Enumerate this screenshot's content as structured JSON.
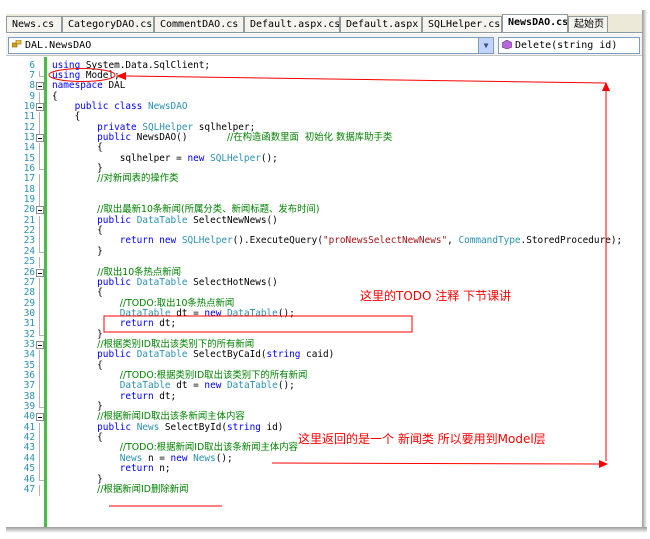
{
  "tabs": [
    {
      "label": "News.cs",
      "active": false
    },
    {
      "label": "CategoryDAO.cs",
      "active": false
    },
    {
      "label": "CommentDAO.cs",
      "active": false
    },
    {
      "label": "Default.aspx.cs",
      "active": false
    },
    {
      "label": "Default.aspx",
      "active": false
    },
    {
      "label": "SQLHelper.cs",
      "active": false
    },
    {
      "label": "NewsDAO.cs",
      "active": true
    },
    {
      "label": "起始页",
      "active": false
    }
  ],
  "navbar": {
    "type_combo": "DAL.NewsDAO",
    "member_combo": "Delete(string id)",
    "type_icon": "class-icon",
    "member_icon": "method-icon",
    "arrow_icon": "chevron-down-icon"
  },
  "colors": {
    "keyword": "#0000ff",
    "type": "#2b91af",
    "comment": "#008000",
    "string": "#a31515",
    "line_number": "#2b91af",
    "annotation": "#ff0000",
    "change_bar": "#4cbb4c"
  },
  "lines": [
    {
      "num": "6",
      "fold": "none",
      "segs": [
        [
          "k",
          "using"
        ],
        [
          "p",
          " System.Data.SqlClient;"
        ]
      ]
    },
    {
      "num": "7",
      "fold": "end",
      "segs": [
        [
          "k",
          "using"
        ],
        [
          "p",
          " Model;"
        ]
      ]
    },
    {
      "num": "8",
      "fold": "box",
      "segs": [
        [
          "k",
          "namespace"
        ],
        [
          "p",
          " DAL"
        ]
      ]
    },
    {
      "num": "9",
      "fold": "vl",
      "segs": [
        [
          "p",
          "{"
        ]
      ]
    },
    {
      "num": "10",
      "fold": "box",
      "segs": [
        [
          "p",
          "    "
        ],
        [
          "k",
          "public class"
        ],
        [
          "p",
          " "
        ],
        [
          "t",
          "NewsDAO"
        ]
      ]
    },
    {
      "num": "11",
      "fold": "vl",
      "segs": [
        [
          "p",
          "    {"
        ]
      ]
    },
    {
      "num": "12",
      "fold": "vl",
      "segs": [
        [
          "p",
          "        "
        ],
        [
          "k",
          "private"
        ],
        [
          "p",
          " "
        ],
        [
          "t",
          "SQLHelper"
        ],
        [
          "p",
          " sqlhelper;"
        ]
      ]
    },
    {
      "num": "13",
      "fold": "box",
      "segs": [
        [
          "p",
          "        "
        ],
        [
          "k",
          "public"
        ],
        [
          "p",
          " NewsDAO()       "
        ],
        [
          "c",
          "//在构造函数里面  初始化 数据库助手类"
        ]
      ]
    },
    {
      "num": "14",
      "fold": "vl",
      "segs": [
        [
          "p",
          "        {"
        ]
      ]
    },
    {
      "num": "15",
      "fold": "vl",
      "segs": [
        [
          "p",
          "            sqlhelper = "
        ],
        [
          "k",
          "new"
        ],
        [
          "p",
          " "
        ],
        [
          "t",
          "SQLHelper"
        ],
        [
          "p",
          "();"
        ]
      ]
    },
    {
      "num": "16",
      "fold": "end",
      "segs": [
        [
          "p",
          "        }"
        ]
      ]
    },
    {
      "num": "17",
      "fold": "vl",
      "segs": [
        [
          "p",
          "        "
        ],
        [
          "c",
          "//对新闻表的操作类"
        ]
      ]
    },
    {
      "num": "18",
      "fold": "vl",
      "segs": [
        [
          "p",
          ""
        ]
      ]
    },
    {
      "num": "19",
      "fold": "vl",
      "segs": [
        [
          "p",
          ""
        ]
      ]
    },
    {
      "num": "20",
      "fold": "box",
      "segs": [
        [
          "p",
          "        "
        ],
        [
          "c",
          "//取出最新10条新闻(所属分类、新闻标题、发布时间)"
        ]
      ]
    },
    {
      "num": "21",
      "fold": "vl",
      "segs": [
        [
          "p",
          "        "
        ],
        [
          "k",
          "public"
        ],
        [
          "p",
          " "
        ],
        [
          "t",
          "DataTable"
        ],
        [
          "p",
          " SelectNewNews()"
        ]
      ]
    },
    {
      "num": "22",
      "fold": "vl",
      "segs": [
        [
          "p",
          "        {"
        ]
      ]
    },
    {
      "num": "23",
      "fold": "vl",
      "segs": [
        [
          "p",
          "            "
        ],
        [
          "k",
          "return new"
        ],
        [
          "p",
          " "
        ],
        [
          "t",
          "SQLHelper"
        ],
        [
          "p",
          "().ExecuteQuery("
        ],
        [
          "s",
          "\"proNewsSelectNewNews\""
        ],
        [
          "p",
          ", "
        ],
        [
          "t",
          "CommandType"
        ],
        [
          "p",
          ".StoredProcedure);"
        ]
      ]
    },
    {
      "num": "24",
      "fold": "end",
      "segs": [
        [
          "p",
          "        }"
        ]
      ]
    },
    {
      "num": "25",
      "fold": "vl",
      "segs": [
        [
          "p",
          ""
        ]
      ]
    },
    {
      "num": "26",
      "fold": "box",
      "segs": [
        [
          "p",
          "        "
        ],
        [
          "c",
          "//取出10条热点新闻"
        ]
      ]
    },
    {
      "num": "27",
      "fold": "vl",
      "segs": [
        [
          "p",
          "        "
        ],
        [
          "k",
          "public"
        ],
        [
          "p",
          " "
        ],
        [
          "t",
          "DataTable"
        ],
        [
          "p",
          " SelectHotNews()"
        ]
      ]
    },
    {
      "num": "28",
      "fold": "vl",
      "segs": [
        [
          "p",
          "        {"
        ]
      ]
    },
    {
      "num": "29",
      "fold": "vl",
      "segs": [
        [
          "p",
          "            "
        ],
        [
          "c",
          "//TODO:取出10条热点新闻"
        ]
      ]
    },
    {
      "num": "30",
      "fold": "vl",
      "segs": [
        [
          "p",
          "            "
        ],
        [
          "t",
          "DataTable"
        ],
        [
          "p",
          " dt = "
        ],
        [
          "k",
          "new"
        ],
        [
          "p",
          " "
        ],
        [
          "t",
          "DataTable"
        ],
        [
          "p",
          "();"
        ]
      ]
    },
    {
      "num": "31",
      "fold": "vl",
      "segs": [
        [
          "p",
          "            "
        ],
        [
          "k",
          "return"
        ],
        [
          "p",
          " dt;"
        ]
      ]
    },
    {
      "num": "32",
      "fold": "end",
      "segs": [
        [
          "p",
          "        }"
        ]
      ]
    },
    {
      "num": "33",
      "fold": "box",
      "segs": [
        [
          "p",
          "        "
        ],
        [
          "c",
          "//根据类别ID取出该类别下的所有新闻"
        ]
      ]
    },
    {
      "num": "34",
      "fold": "vl",
      "segs": [
        [
          "p",
          "        "
        ],
        [
          "k",
          "public"
        ],
        [
          "p",
          " "
        ],
        [
          "t",
          "DataTable"
        ],
        [
          "p",
          " SelectByCaId("
        ],
        [
          "k",
          "string"
        ],
        [
          "p",
          " caid)"
        ]
      ]
    },
    {
      "num": "35",
      "fold": "vl",
      "segs": [
        [
          "p",
          "        {"
        ]
      ]
    },
    {
      "num": "36",
      "fold": "vl",
      "segs": [
        [
          "p",
          "            "
        ],
        [
          "c",
          "//TODO:根据类别ID取出该类别下的所有新闻"
        ]
      ]
    },
    {
      "num": "37",
      "fold": "vl",
      "segs": [
        [
          "p",
          "            "
        ],
        [
          "t",
          "DataTable"
        ],
        [
          "p",
          " dt = "
        ],
        [
          "k",
          "new"
        ],
        [
          "p",
          " "
        ],
        [
          "t",
          "DataTable"
        ],
        [
          "p",
          "();"
        ]
      ]
    },
    {
      "num": "38",
      "fold": "vl",
      "segs": [
        [
          "p",
          "            "
        ],
        [
          "k",
          "return"
        ],
        [
          "p",
          " dt;"
        ]
      ]
    },
    {
      "num": "39",
      "fold": "end",
      "segs": [
        [
          "p",
          "        }"
        ]
      ]
    },
    {
      "num": "40",
      "fold": "box",
      "segs": [
        [
          "p",
          "        "
        ],
        [
          "c",
          "//根据新闻ID取出该条新闻主体内容"
        ]
      ]
    },
    {
      "num": "41",
      "fold": "vl",
      "segs": [
        [
          "p",
          "        "
        ],
        [
          "k",
          "public"
        ],
        [
          "p",
          " "
        ],
        [
          "t",
          "News"
        ],
        [
          "p",
          " SelectById("
        ],
        [
          "k",
          "string"
        ],
        [
          "p",
          " id)"
        ]
      ]
    },
    {
      "num": "42",
      "fold": "vl",
      "segs": [
        [
          "p",
          "        {"
        ]
      ]
    },
    {
      "num": "43",
      "fold": "vl",
      "segs": [
        [
          "p",
          "            "
        ],
        [
          "c",
          "//TODO:根据新闻ID取出该条新闻主体内容"
        ]
      ]
    },
    {
      "num": "44",
      "fold": "vl",
      "segs": [
        [
          "p",
          "            "
        ],
        [
          "t",
          "News"
        ],
        [
          "p",
          " n = "
        ],
        [
          "k",
          "new"
        ],
        [
          "p",
          " "
        ],
        [
          "t",
          "News"
        ],
        [
          "p",
          "();"
        ]
      ]
    },
    {
      "num": "45",
      "fold": "vl",
      "segs": [
        [
          "p",
          "            "
        ],
        [
          "k",
          "return"
        ],
        [
          "p",
          " n;"
        ]
      ]
    },
    {
      "num": "46",
      "fold": "end",
      "segs": [
        [
          "p",
          "        }"
        ]
      ]
    },
    {
      "num": "47",
      "fold": "vl",
      "segs": [
        [
          "p",
          "        "
        ],
        [
          "c",
          "//根据新闻ID删除新闻"
        ]
      ]
    }
  ],
  "annotations": {
    "todo_note": "这里的TODO 注释  下节课讲",
    "model_note": "这里返回的是一个 新闻类    所以要用到Model层"
  }
}
